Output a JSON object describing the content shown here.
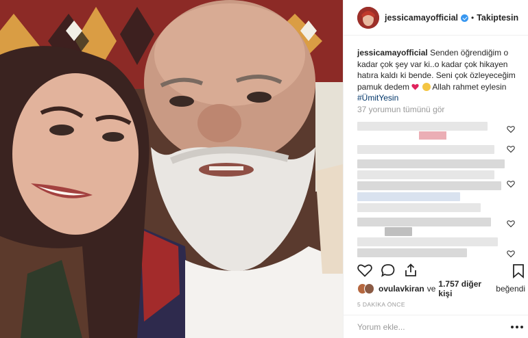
{
  "post": {
    "username": "jessicamayofficial",
    "verified": true,
    "separator": "•",
    "follow_label": "Takiptesin"
  },
  "caption": {
    "username": "jessicamayofficial",
    "text_part1": "Senden öğrendiğim o kadar çok şey var ki..o kadar çok hikayen hatıra kaldı ki bende. Seni çok özleyeceğim pamuk dedem",
    "text_part2": "Allah rahmet eylesin",
    "hashtag": "#ÜmitYesin"
  },
  "comments": {
    "view_all_label": "37 yorumun tümünü gör",
    "blurred": true
  },
  "likes": {
    "liker": "ovulavkiran",
    "middle": "ve",
    "others": "1.757 diğer kişi",
    "suffix": "beğendi"
  },
  "timestamp": "5 DAKİKA ÖNCE",
  "comment_input": {
    "placeholder": "Yorum ekle..."
  },
  "icons": {
    "like": "heart-icon",
    "comment": "comment-icon",
    "share": "share-icon",
    "save": "bookmark-icon",
    "more": "more-options-icon"
  },
  "colors": {
    "verified_blue": "#3897f0",
    "hashtag_blue": "#003569",
    "muted_gray": "#999999",
    "text": "#262626"
  }
}
